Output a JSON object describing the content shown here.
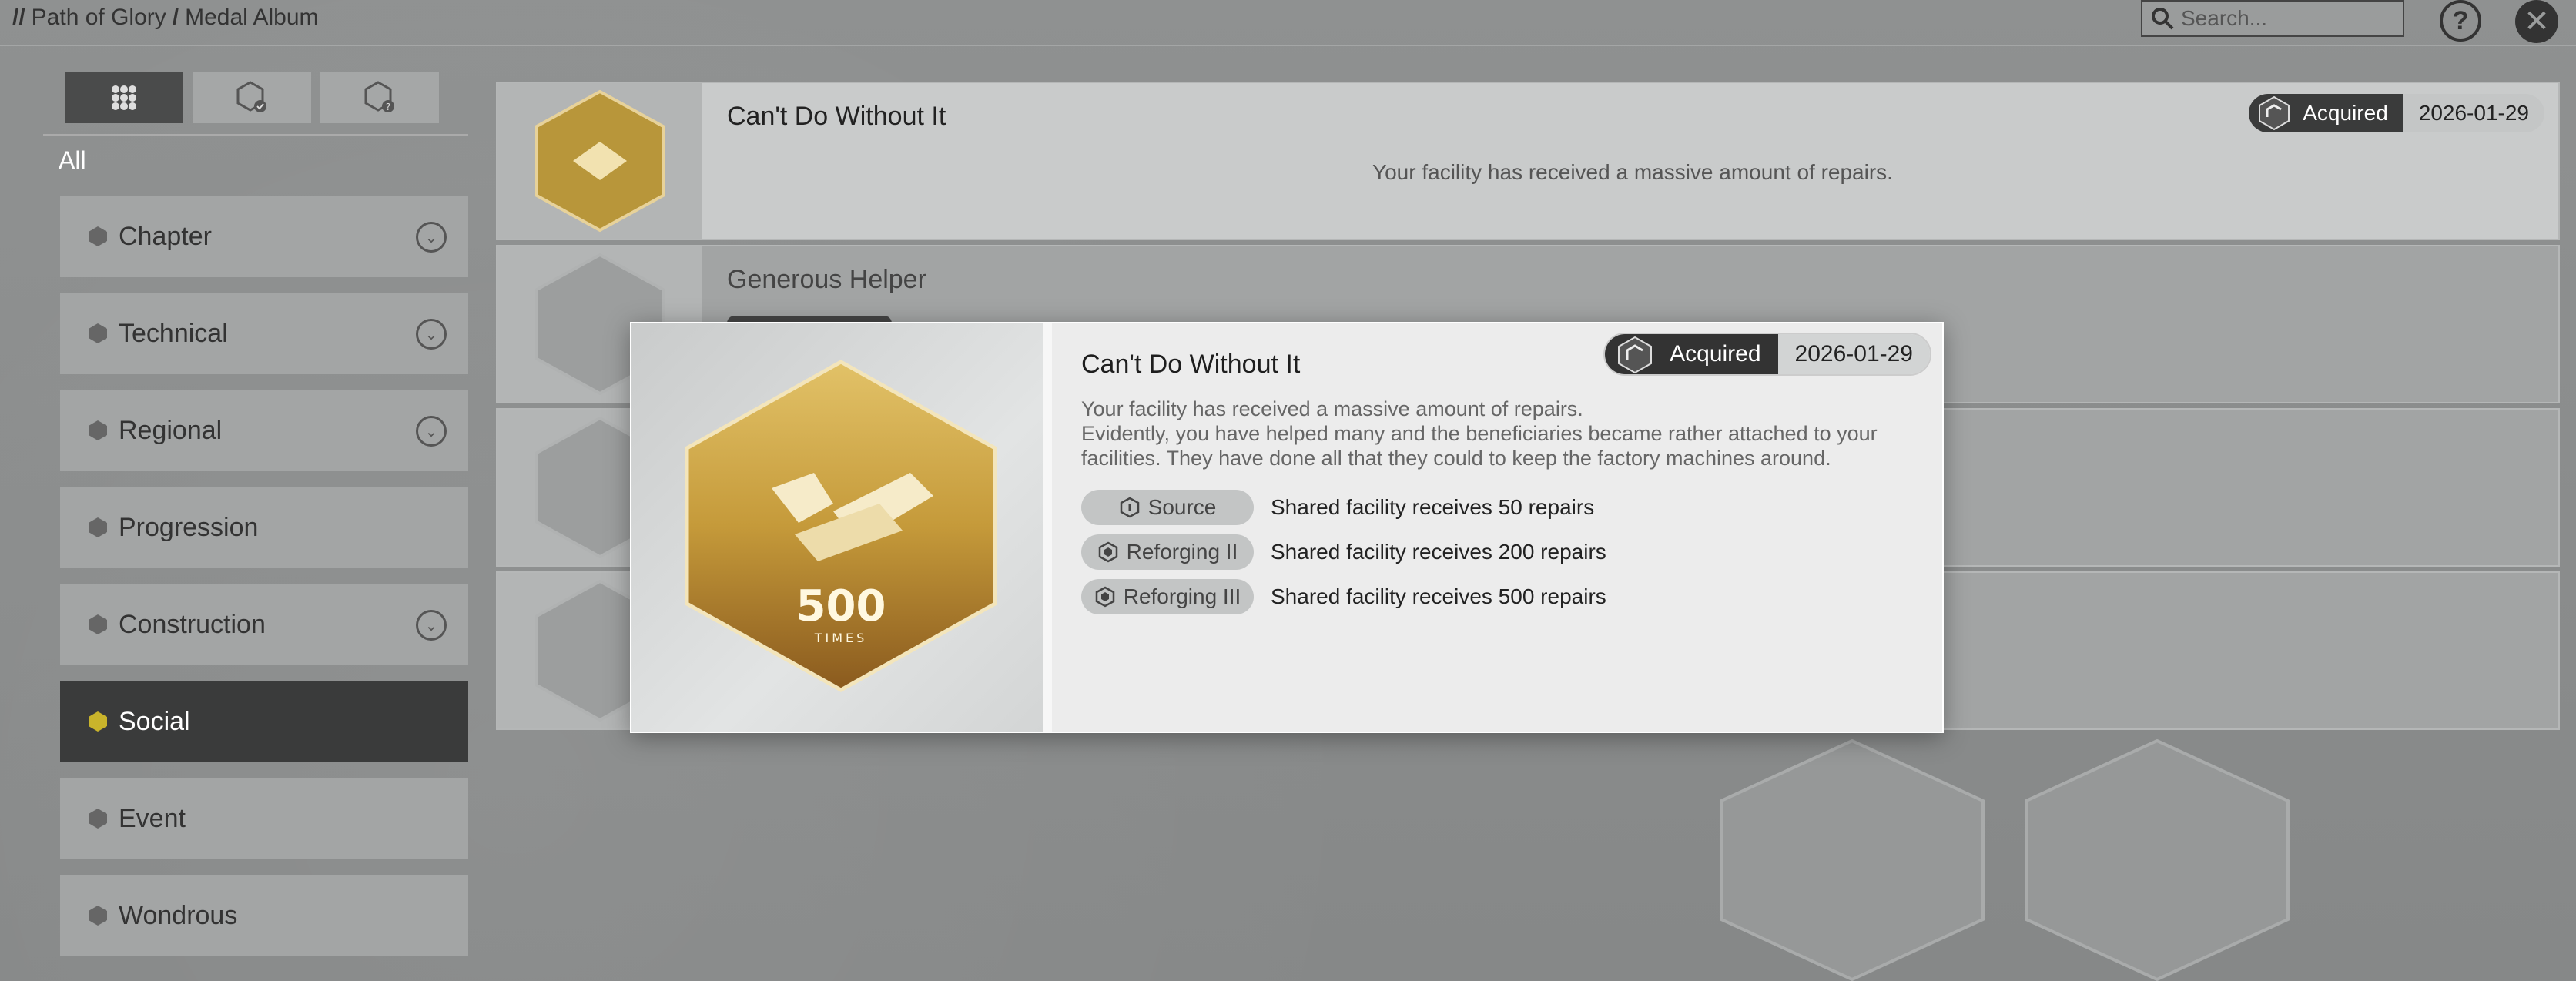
{
  "breadcrumb": {
    "root": "Path of Glory",
    "current": "Medal Album"
  },
  "search": {
    "placeholder": "Search..."
  },
  "sidebar": {
    "all_label": "All",
    "categories": [
      {
        "label": "Chapter",
        "expandable": true
      },
      {
        "label": "Technical",
        "expandable": true
      },
      {
        "label": "Regional",
        "expandable": true
      },
      {
        "label": "Progression",
        "expandable": false
      },
      {
        "label": "Construction",
        "expandable": true
      },
      {
        "label": "Social",
        "expandable": false,
        "active": true
      },
      {
        "label": "Event",
        "expandable": false
      },
      {
        "label": "Wondrous",
        "expandable": false
      }
    ]
  },
  "medals": [
    {
      "title": "Can't Do Without It",
      "desc": "Your facility has received a massive amount of repairs.",
      "status": "Acquired",
      "date": "2026-01-29"
    },
    {
      "title": "Generous Helper"
    }
  ],
  "modal": {
    "title": "Can't Do Without It",
    "status": "Acquired",
    "date": "2026-01-29",
    "desc_line1": "Your facility has received a massive amount of repairs.",
    "desc_line2": "Evidently, you have helped many and the beneficiaries became rather attached to your facilities. They have done all that they could to keep the factory machines around.",
    "medal_count": "500",
    "medal_unit": "TIMES",
    "requirements": [
      {
        "tag": "Source",
        "text": "Shared facility receives 50 repairs"
      },
      {
        "tag": "Reforging II",
        "text": "Shared facility receives 200 repairs"
      },
      {
        "tag": "Reforging III",
        "text": "Shared facility receives 500 repairs"
      }
    ]
  },
  "colors": {
    "gold": "#c9a441",
    "dark": "#3a3b3b",
    "panel": "#ececec"
  }
}
